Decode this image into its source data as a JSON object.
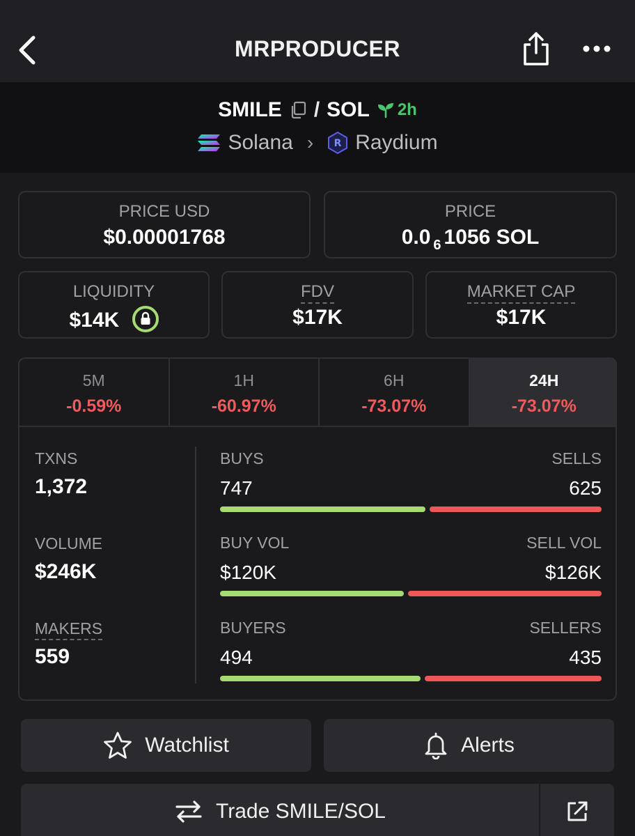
{
  "header": {
    "title": "MRPRODUCER",
    "back_icon": "chevron-left-icon",
    "share_icon": "share-icon",
    "more_icon": "more-horizontal-icon"
  },
  "pair": {
    "base": "SMILE",
    "separator": "/",
    "quote": "SOL",
    "age": "2h",
    "chain": "Solana",
    "dex": "Raydium"
  },
  "stats": {
    "price_usd_label": "PRICE USD",
    "price_usd": "$0.00001768",
    "price_label": "PRICE",
    "price_prefix": "0.0",
    "price_sub": "6",
    "price_suffix": "1056 SOL",
    "liquidity_label": "LIQUIDITY",
    "liquidity": "$14K",
    "fdv_label": "FDV",
    "fdv": "$17K",
    "mcap_label": "MARKET CAP",
    "mcap": "$17K"
  },
  "tabs": [
    {
      "label": "5M",
      "change": "-0.59%"
    },
    {
      "label": "1H",
      "change": "-60.97%"
    },
    {
      "label": "6H",
      "change": "-73.07%"
    },
    {
      "label": "24H",
      "change": "-73.07%"
    }
  ],
  "metrics": {
    "txns_label": "TXNS",
    "txns": "1,372",
    "volume_label": "VOLUME",
    "volume": "$246K",
    "makers_label": "MAKERS",
    "makers": "559"
  },
  "ratios": [
    {
      "left_label": "BUYS",
      "right_label": "SELLS",
      "left_value": "747",
      "right_value": "625",
      "left_share": 0.544
    },
    {
      "left_label": "BUY VOL",
      "right_label": "SELL VOL",
      "left_value": "$120K",
      "right_value": "$126K",
      "left_share": 0.488
    },
    {
      "left_label": "BUYERS",
      "right_label": "SELLERS",
      "left_value": "494",
      "right_value": "435",
      "left_share": 0.532
    }
  ],
  "actions": {
    "watchlist": "Watchlist",
    "alerts": "Alerts",
    "trade": "Trade SMILE/SOL"
  },
  "colors": {
    "positive": "#a6db72",
    "negative": "#ef5757",
    "age": "#4cc46e"
  }
}
